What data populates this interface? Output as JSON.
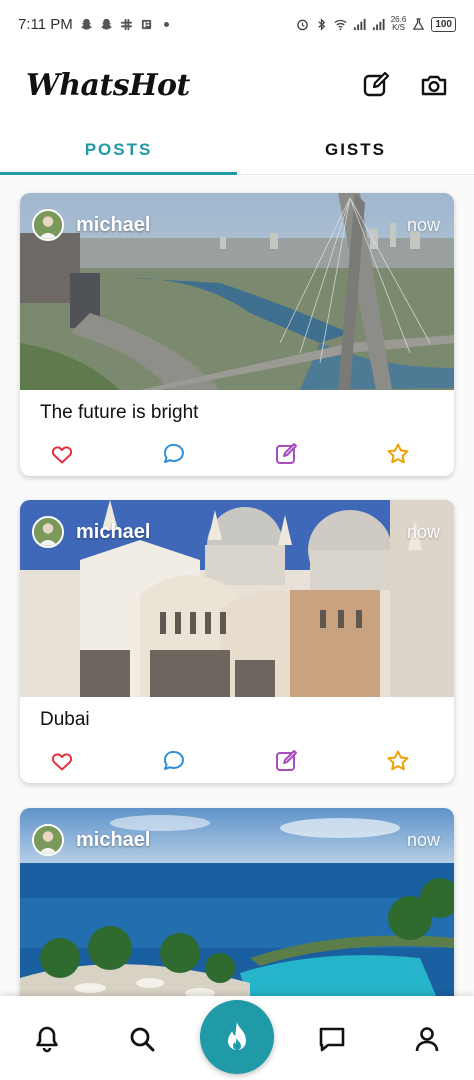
{
  "status_bar": {
    "time": "7:11 PM",
    "net_speed_value": "26.6",
    "net_speed_unit": "K/S",
    "battery": "100"
  },
  "app_bar": {
    "title": "WhatsHot",
    "icons": [
      "edit-icon",
      "camera-icon"
    ]
  },
  "tabs": [
    {
      "label": "POSTS",
      "active": true
    },
    {
      "label": "GISTS",
      "active": false
    }
  ],
  "posts": [
    {
      "username": "michael",
      "timestamp": "now",
      "caption": "The future is bright",
      "image": "city-bridge-photo"
    },
    {
      "username": "michael",
      "timestamp": "now",
      "caption": "Dubai",
      "image": "cathedral-photo"
    },
    {
      "username": "michael",
      "timestamp": "now",
      "caption": "",
      "image": "beach-resort-photo"
    }
  ],
  "post_actions": [
    "heart-icon",
    "comment-icon",
    "edit-icon",
    "star-icon"
  ],
  "bottom_nav": [
    "bell-icon",
    "search-icon",
    "fire-icon",
    "chat-icon",
    "profile-icon"
  ],
  "colors": {
    "accent": "#1f9aa6",
    "heart": "#e2323f",
    "comment": "#2f8fd6",
    "edit": "#a84cc0",
    "star": "#f0a000"
  }
}
